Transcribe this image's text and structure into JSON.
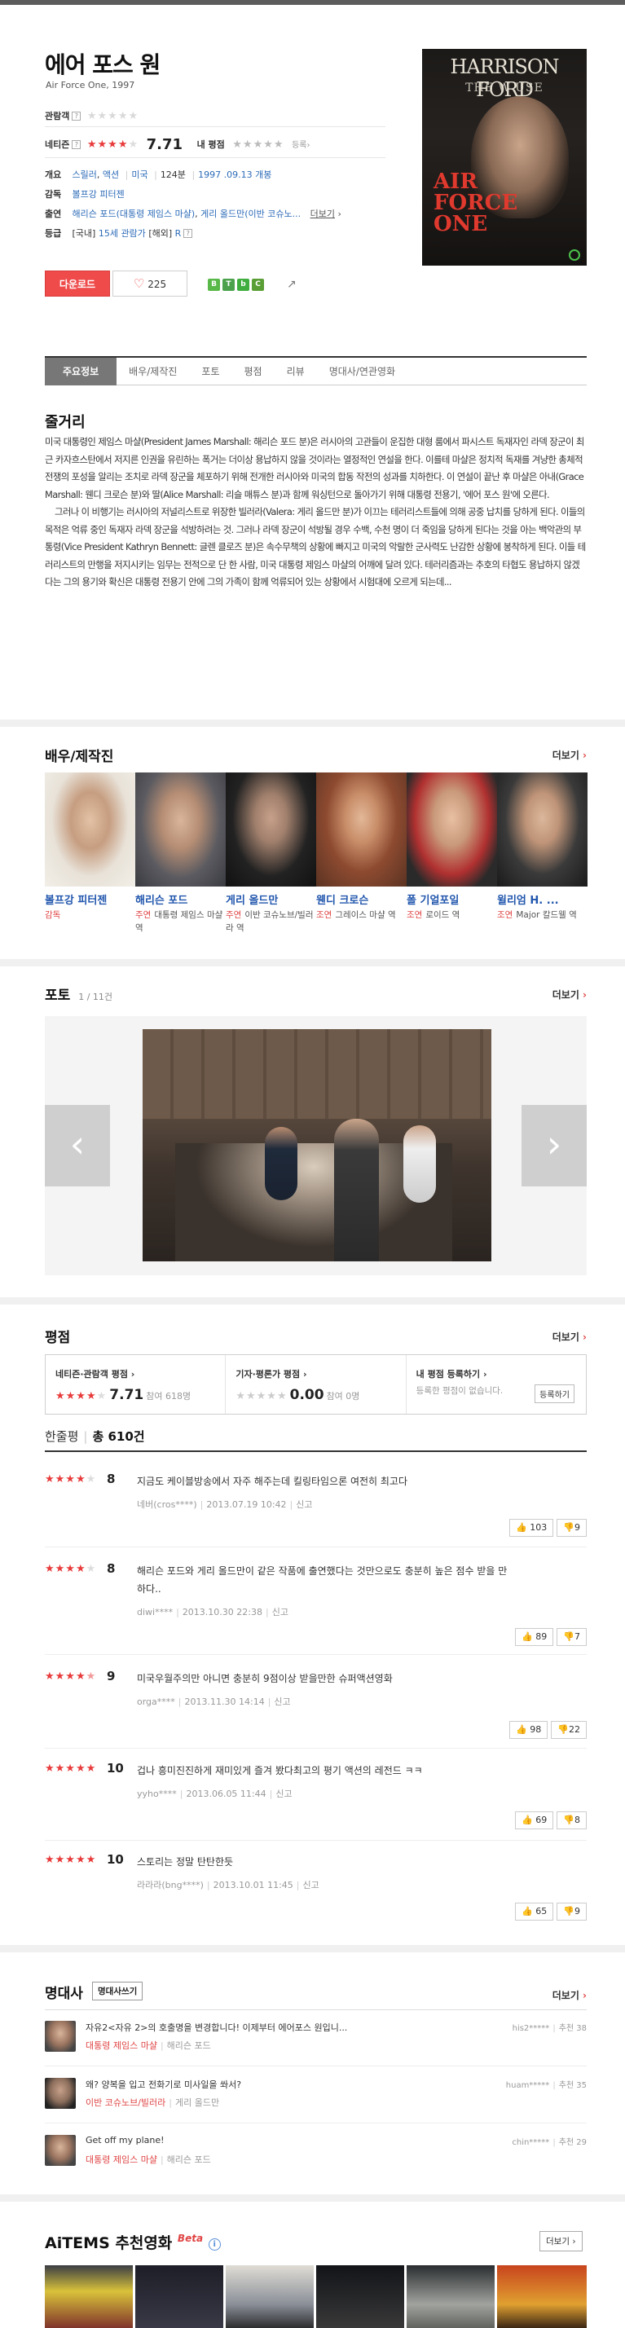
{
  "movie": {
    "title": "에어 포스 원",
    "subtitle": "Air Force One, 1997",
    "poster": {
      "actor": "HARRISON FORD",
      "tagline": "THE W     USE",
      "title_line1": "AIR",
      "title_line2": "FORCE",
      "title_line3": "ONE"
    }
  },
  "ratings": {
    "viewer_label": "관람객",
    "netizen_label": "네티즌",
    "netizen_score": "7.71",
    "my_label": "내 평점",
    "register_label": "등록"
  },
  "info": {
    "outline_label": "개요",
    "genre1": "스릴러",
    "genre2": "액션",
    "country": "미국",
    "runtime": "124분",
    "release": "1997 .09.13 개봉",
    "director_label": "감독",
    "director": "볼프강 피터젠",
    "cast_label": "출연",
    "cast1": "해리슨 포드(대통령 제임스 마샬)",
    "cast2": "게리 올드만(이반 코슈노...",
    "cast_more": "더보기",
    "grade_label": "등급",
    "grade1": "[국내]",
    "grade1_val": "15세 관람가",
    "grade2": "[해외]",
    "grade2_val": "R"
  },
  "actions": {
    "download": "다운로드",
    "like_count": "225"
  },
  "tabs": [
    "주요정보",
    "배우/제작진",
    "포토",
    "평점",
    "리뷰",
    "명대사/연관영화"
  ],
  "synopsis": {
    "title": "줄거리",
    "p1": "미국 대통령인 제임스 마샬(President James Marshall: 해리슨 포드 분)은 러시아의 고관들이 운집한 대형 룸에서 파시스트 독재자인 라덱 장군이 최근 카자흐스탄에서 저지른 인권을 유린하는 폭거는 더이상 용납하지 않을 것이라는 열정적인 연설을 한다. 이를테 마샬은 정치적 독재를 겨냥한 총체적 전쟁의 포성을 알리는 조치로 라덱 장군을 체포하기 위해 전개한 러시아와 미국의 합동 작전의 성과를 치하한다. 이 연설이 끝난 후 마샬은 아내(Grace Marshall: 웬디 크로슨 분)와 딸(Alice Marshall: 리슬 매튜스 분)과 함께 워싱턴으로 돌아가기 위해 대통령 전용기, '에어 포스 원'에 오른다.",
    "p2": "그러나 이 비행기는 러시아의 저널리스트로 위장한 빌러라(Valera: 게리 올드만 분)가 이끄는 테러리스트들에 의해 공중 납치를 당하게 된다. 이들의 목적은 억류 중인 독재자 라덱 장군을 석방하려는 것. 그러나 라덱 장군이 석방될 경우 수백, 수천 명이 더 죽임을 당하게 된다는 것을 아는 백악관의 부통령(Vice President Kathryn Bennett: 글렌 클로즈 분)은 속수무책의 상황에 빠지고 미국의 악랄한 군사력도 난감한 상황에 봉착하게 된다. 이들 테러리스트의 만행을 저지시키는 임무는 전적으로 단 한 사람, 미국 대통령 제임스 마샬의 어깨에 달려 있다. 테러리즘과는 추호의 타협도 용납하지 않겠다는 그의 용기와 확신은 대통령 전용기 안에 그의 가족이 함께 억류되어 있는 상황에서 시험대에 오르게 되는데..."
  },
  "cast_section": {
    "title": "배우/제작진",
    "more": "더보기",
    "people": [
      {
        "name": "볼프강 피터젠",
        "role_type": "감독",
        "role": ""
      },
      {
        "name": "해리슨 포드",
        "role_type": "주연",
        "role": "대통령 제임스 마샬 역"
      },
      {
        "name": "게리 올드만",
        "role_type": "주연",
        "role": "이반 코슈노브/빌러라 역"
      },
      {
        "name": "웬디 크로슨",
        "role_type": "조연",
        "role": "그레이스 마샬 역"
      },
      {
        "name": "폴 기얼포일",
        "role_type": "조연",
        "role": "로이드 역"
      },
      {
        "name": "윌리엄 H. ...",
        "role_type": "조연",
        "role": "Major 칼드웰 역"
      }
    ]
  },
  "photo_section": {
    "title": "포토",
    "counter": "1 / 11건",
    "more": "더보기"
  },
  "rating_section": {
    "title": "평점",
    "more": "더보기",
    "netizen_label": "네티즌·관람객 평점",
    "netizen_score": "7.71",
    "netizen_count": "참여 618명",
    "press_label": "기자·평론가 평점",
    "press_score": "0.00",
    "press_count": "참여 0명",
    "my_label": "내 평점 등록하기",
    "my_text": "등록한 평점이 없습니다.",
    "register_btn": "등록하기",
    "oneline_label": "한줄평",
    "oneline_total": "총 610건"
  },
  "reviews": [
    {
      "score": "8",
      "text": "지금도 케이블방송에서 자주 해주는데 킬링타임으론 여전히 최고다",
      "user": "네버(cros****)",
      "date": "2013.07.19 10:42",
      "report": "신고",
      "up": "103",
      "down": "9"
    },
    {
      "score": "8",
      "text": "해리슨 포드와 게리 올드만이 같은 작품에 출연했다는 것만으로도 충분히 높은 점수 받을 만하다..",
      "user": "diwi****",
      "date": "2013.10.30 22:38",
      "report": "신고",
      "up": "89",
      "down": "7"
    },
    {
      "score": "9",
      "text": "미국우월주의만 아니면 충분히 9점이상 받을만한 슈퍼액션영화",
      "user": "orga****",
      "date": "2013.11.30 14:14",
      "report": "신고",
      "up": "98",
      "down": "22"
    },
    {
      "score": "10",
      "text": "겁나 흥미진진하게 재미있게 즐겨 봤다최고의 평기 액션의 레전드 ㅋㅋ",
      "user": "yyho****",
      "date": "2013.06.05 11:44",
      "report": "신고",
      "up": "69",
      "down": "8"
    },
    {
      "score": "10",
      "text": "스토리는 정말 탄탄한듯",
      "user": "라라라(bng****)",
      "date": "2013.10.01 11:45",
      "report": "신고",
      "up": "65",
      "down": "9"
    }
  ],
  "quotes_section": {
    "title": "명대사",
    "btn": "명대사쓰기",
    "more": "더보기",
    "items": [
      {
        "text": "자유2&lt;자유 2&gt;의 호출명을 변경합니다! 이제부터 에어포스 원입니...",
        "who": "대통령 제임스 마샬",
        "actor": "해리슨 포드",
        "user": "his2*****",
        "rec": "추천 38"
      },
      {
        "text": "왜? 양복을 입고 전화기로 미사일을 쏴서?",
        "who": "이반 코슈노브/빌러라",
        "actor": "게리 올드만",
        "user": "huam*****",
        "rec": "추천 35"
      },
      {
        "text": "Get off my plane!",
        "who": "대통령 제임스 마샬",
        "actor": "해리슨 포드",
        "user": "chin*****",
        "rec": "추천 29"
      }
    ]
  },
  "aitems": {
    "title": "AiTEMS 추천영화",
    "beta": "Beta",
    "more": "더보기"
  }
}
